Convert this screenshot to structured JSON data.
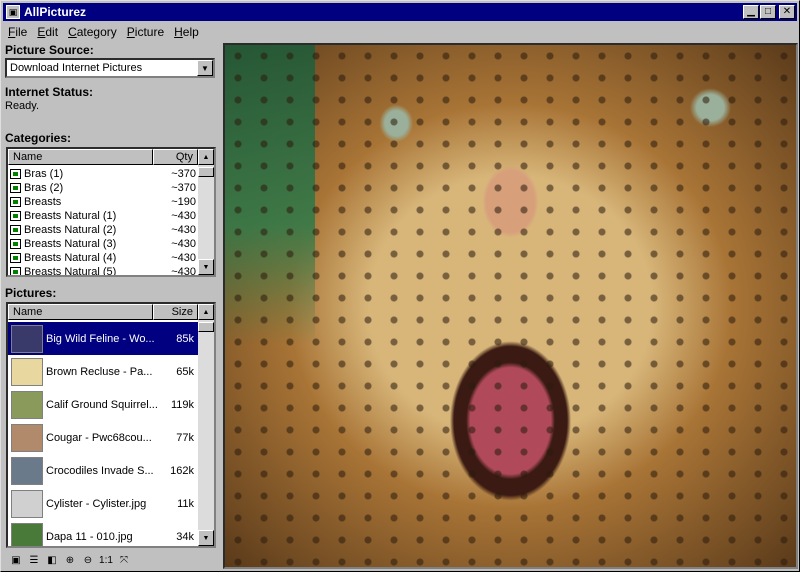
{
  "app": {
    "title": "AllPicturez",
    "icon_label": "▣"
  },
  "window_controls": {
    "minimize": "▁",
    "maximize": "□",
    "close": "✕"
  },
  "menu": [
    {
      "label": "File",
      "mnemonic": "F",
      "rest": "ile"
    },
    {
      "label": "Edit",
      "mnemonic": "E",
      "rest": "dit"
    },
    {
      "label": "Category",
      "mnemonic": "C",
      "rest": "ategory"
    },
    {
      "label": "Picture",
      "mnemonic": "P",
      "rest": "icture"
    },
    {
      "label": "Help",
      "mnemonic": "H",
      "rest": "elp"
    }
  ],
  "source": {
    "label": "Picture Source:",
    "selected": "Download Internet Pictures"
  },
  "internet": {
    "label": "Internet Status:",
    "status": "Ready."
  },
  "categories": {
    "label": "Categories:",
    "columns": [
      "Name",
      "Qty"
    ],
    "items": [
      {
        "name": "Bras (1)",
        "qty": "~370"
      },
      {
        "name": "Bras (2)",
        "qty": "~370"
      },
      {
        "name": "Breasts",
        "qty": "~190"
      },
      {
        "name": "Breasts Natural (1)",
        "qty": "~430"
      },
      {
        "name": "Breasts Natural (2)",
        "qty": "~430"
      },
      {
        "name": "Breasts Natural (3)",
        "qty": "~430"
      },
      {
        "name": "Breasts Natural (4)",
        "qty": "~430"
      },
      {
        "name": "Breasts Natural (5)",
        "qty": "~430"
      }
    ]
  },
  "pictures": {
    "label": "Pictures:",
    "columns": [
      "Name",
      "Size"
    ],
    "items": [
      {
        "name": "Big Wild Feline - Wo...",
        "size": "85k",
        "selected": true,
        "color": "#3a3a6a"
      },
      {
        "name": "Brown Recluse - Pa...",
        "size": "65k",
        "selected": false,
        "color": "#e8d8a0"
      },
      {
        "name": "Calif Ground Squirrel...",
        "size": "119k",
        "selected": false,
        "color": "#8a9a5a"
      },
      {
        "name": "Cougar - Pwc68cou...",
        "size": "77k",
        "selected": false,
        "color": "#b08a6a"
      },
      {
        "name": "Crocodiles Invade S...",
        "size": "162k",
        "selected": false,
        "color": "#6a7a8a"
      },
      {
        "name": "Cylister - Cylister.jpg",
        "size": "11k",
        "selected": false,
        "color": "#d0d0d0"
      },
      {
        "name": "Dapa 11 - 010.jpg",
        "size": "34k",
        "selected": false,
        "color": "#4a7a3a"
      }
    ]
  },
  "toolbar": {
    "tools": [
      {
        "name": "thumbnail-view-icon",
        "glyph": "▣"
      },
      {
        "name": "list-view-icon",
        "glyph": "☰"
      },
      {
        "name": "split-view-icon",
        "glyph": "◧"
      },
      {
        "name": "zoom-in-icon",
        "glyph": "⊕"
      },
      {
        "name": "zoom-out-icon",
        "glyph": "⊖"
      },
      {
        "name": "actual-size-icon",
        "glyph": "1:1"
      },
      {
        "name": "fit-window-icon",
        "glyph": "⤧"
      }
    ]
  }
}
